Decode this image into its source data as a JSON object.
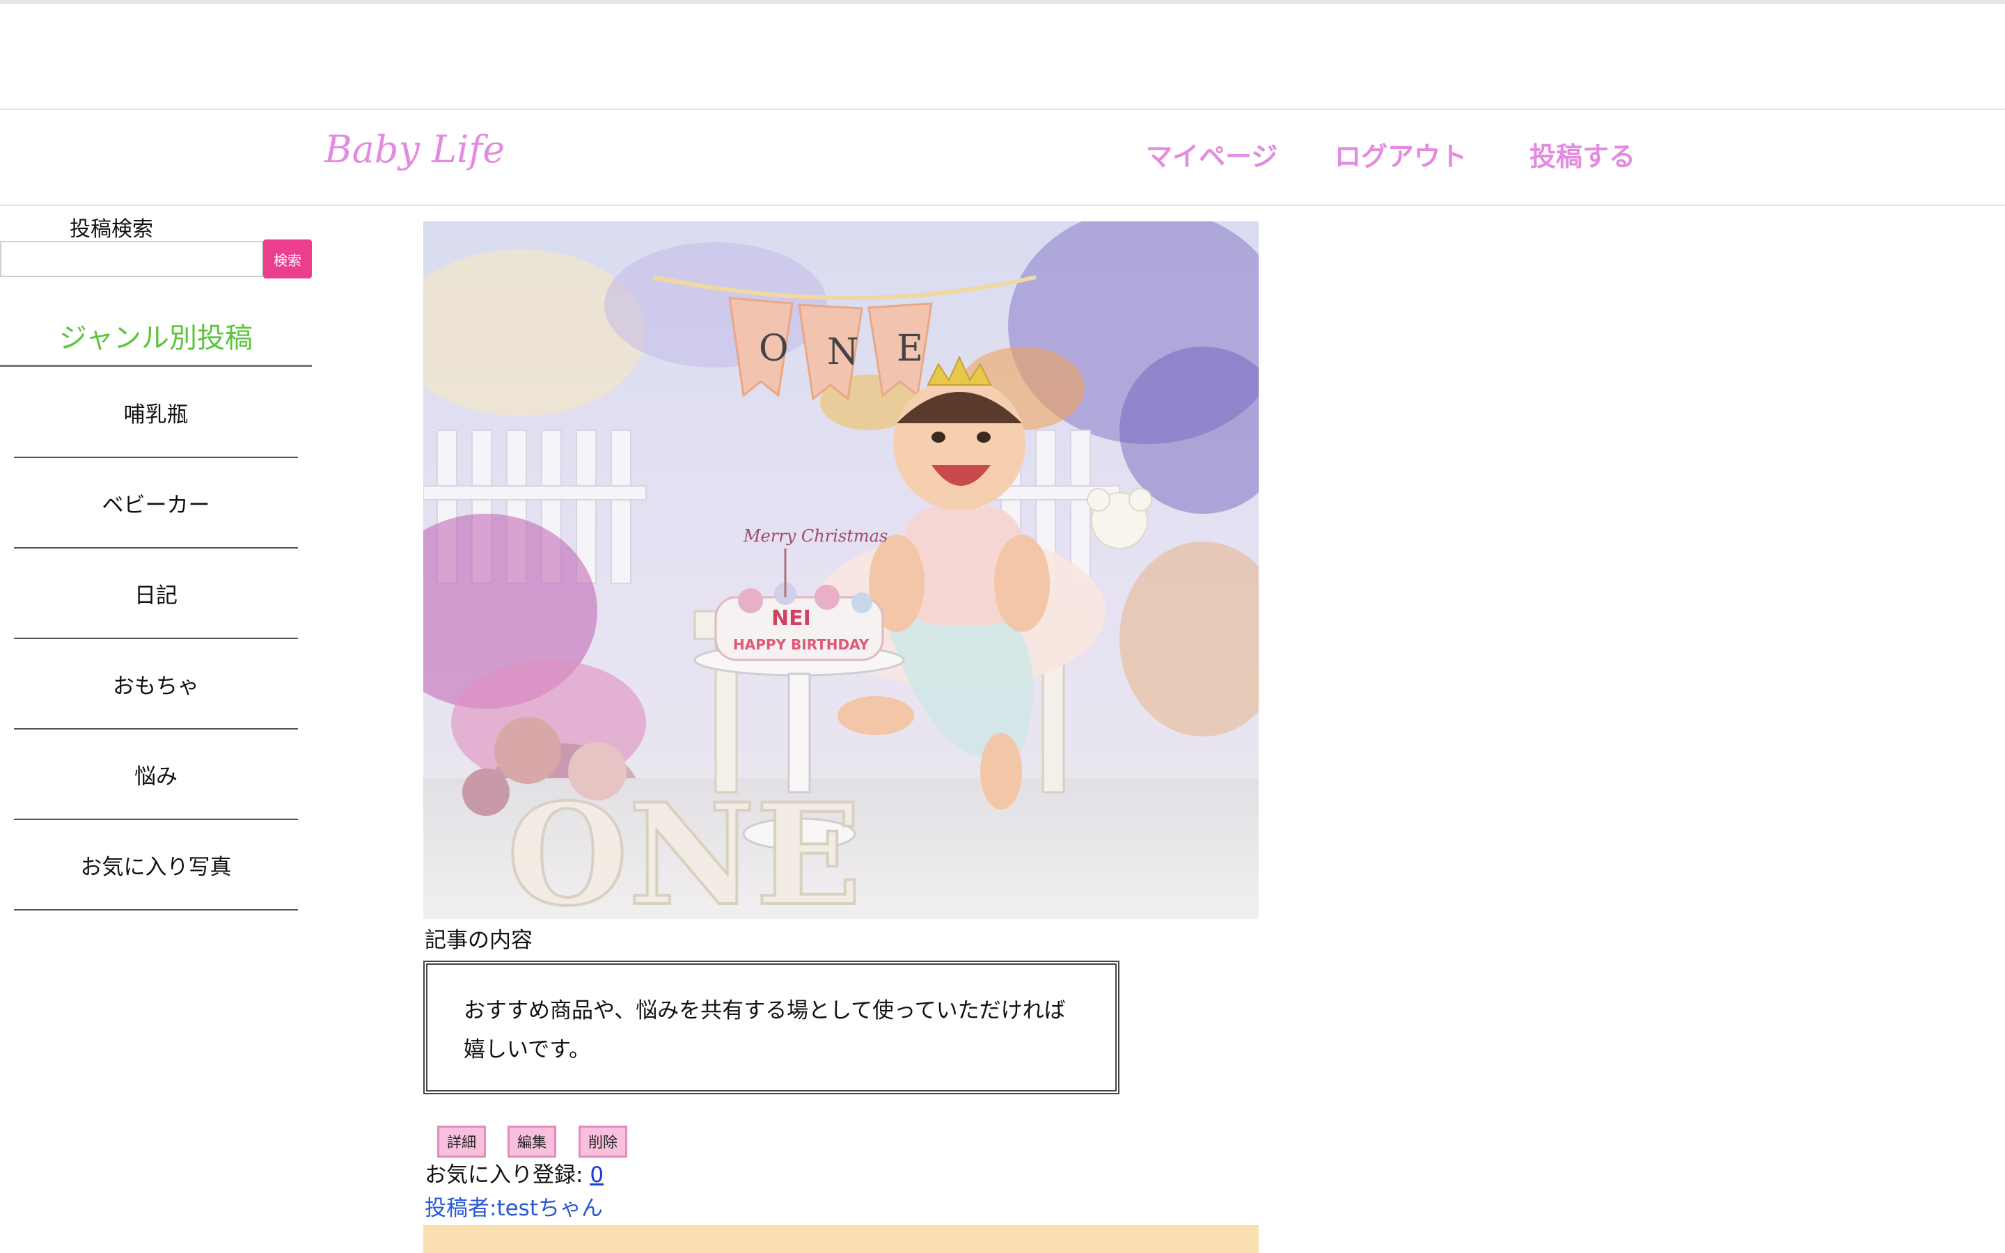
{
  "header": {
    "logo": "Baby Life",
    "nav": [
      {
        "label": "マイページ"
      },
      {
        "label": "ログアウト"
      },
      {
        "label": "投稿する"
      }
    ]
  },
  "sidebar": {
    "search_label": "投稿検索",
    "search_value": "",
    "search_button": "検索",
    "genre_title": "ジャンル別投稿",
    "genres": [
      {
        "label": "哺乳瓶"
      },
      {
        "label": "ベビーカー"
      },
      {
        "label": "日記"
      },
      {
        "label": "おもちゃ"
      },
      {
        "label": "悩み"
      },
      {
        "label": "お気に入り写真"
      }
    ]
  },
  "post": {
    "image_banner_letters": [
      "O",
      "N",
      "E"
    ],
    "image_cake_text": "NEI",
    "image_cake_sub": "HAPPY BIRTHDAY",
    "image_topper": "Merry Christmas",
    "image_letters": "ONE",
    "content_label": "記事の内容",
    "content_text": "おすすめ商品や、悩みを共有する場として使っていただければ嬉しいです。",
    "actions": [
      {
        "label": "詳細"
      },
      {
        "label": "編集"
      },
      {
        "label": "削除"
      }
    ],
    "favorite_label": "お気に入り登録: ",
    "favorite_count": "0",
    "author": "投稿者:testちゃん"
  },
  "colors": {
    "accent_pink": "#e38be0",
    "search_button": "#ec3e8e",
    "genre_title": "#5ec43c",
    "action_button": "#f8c0dc",
    "link_blue": "#1a3dd8",
    "author_blue": "#2a58d6",
    "strip": "#fae0b0"
  }
}
